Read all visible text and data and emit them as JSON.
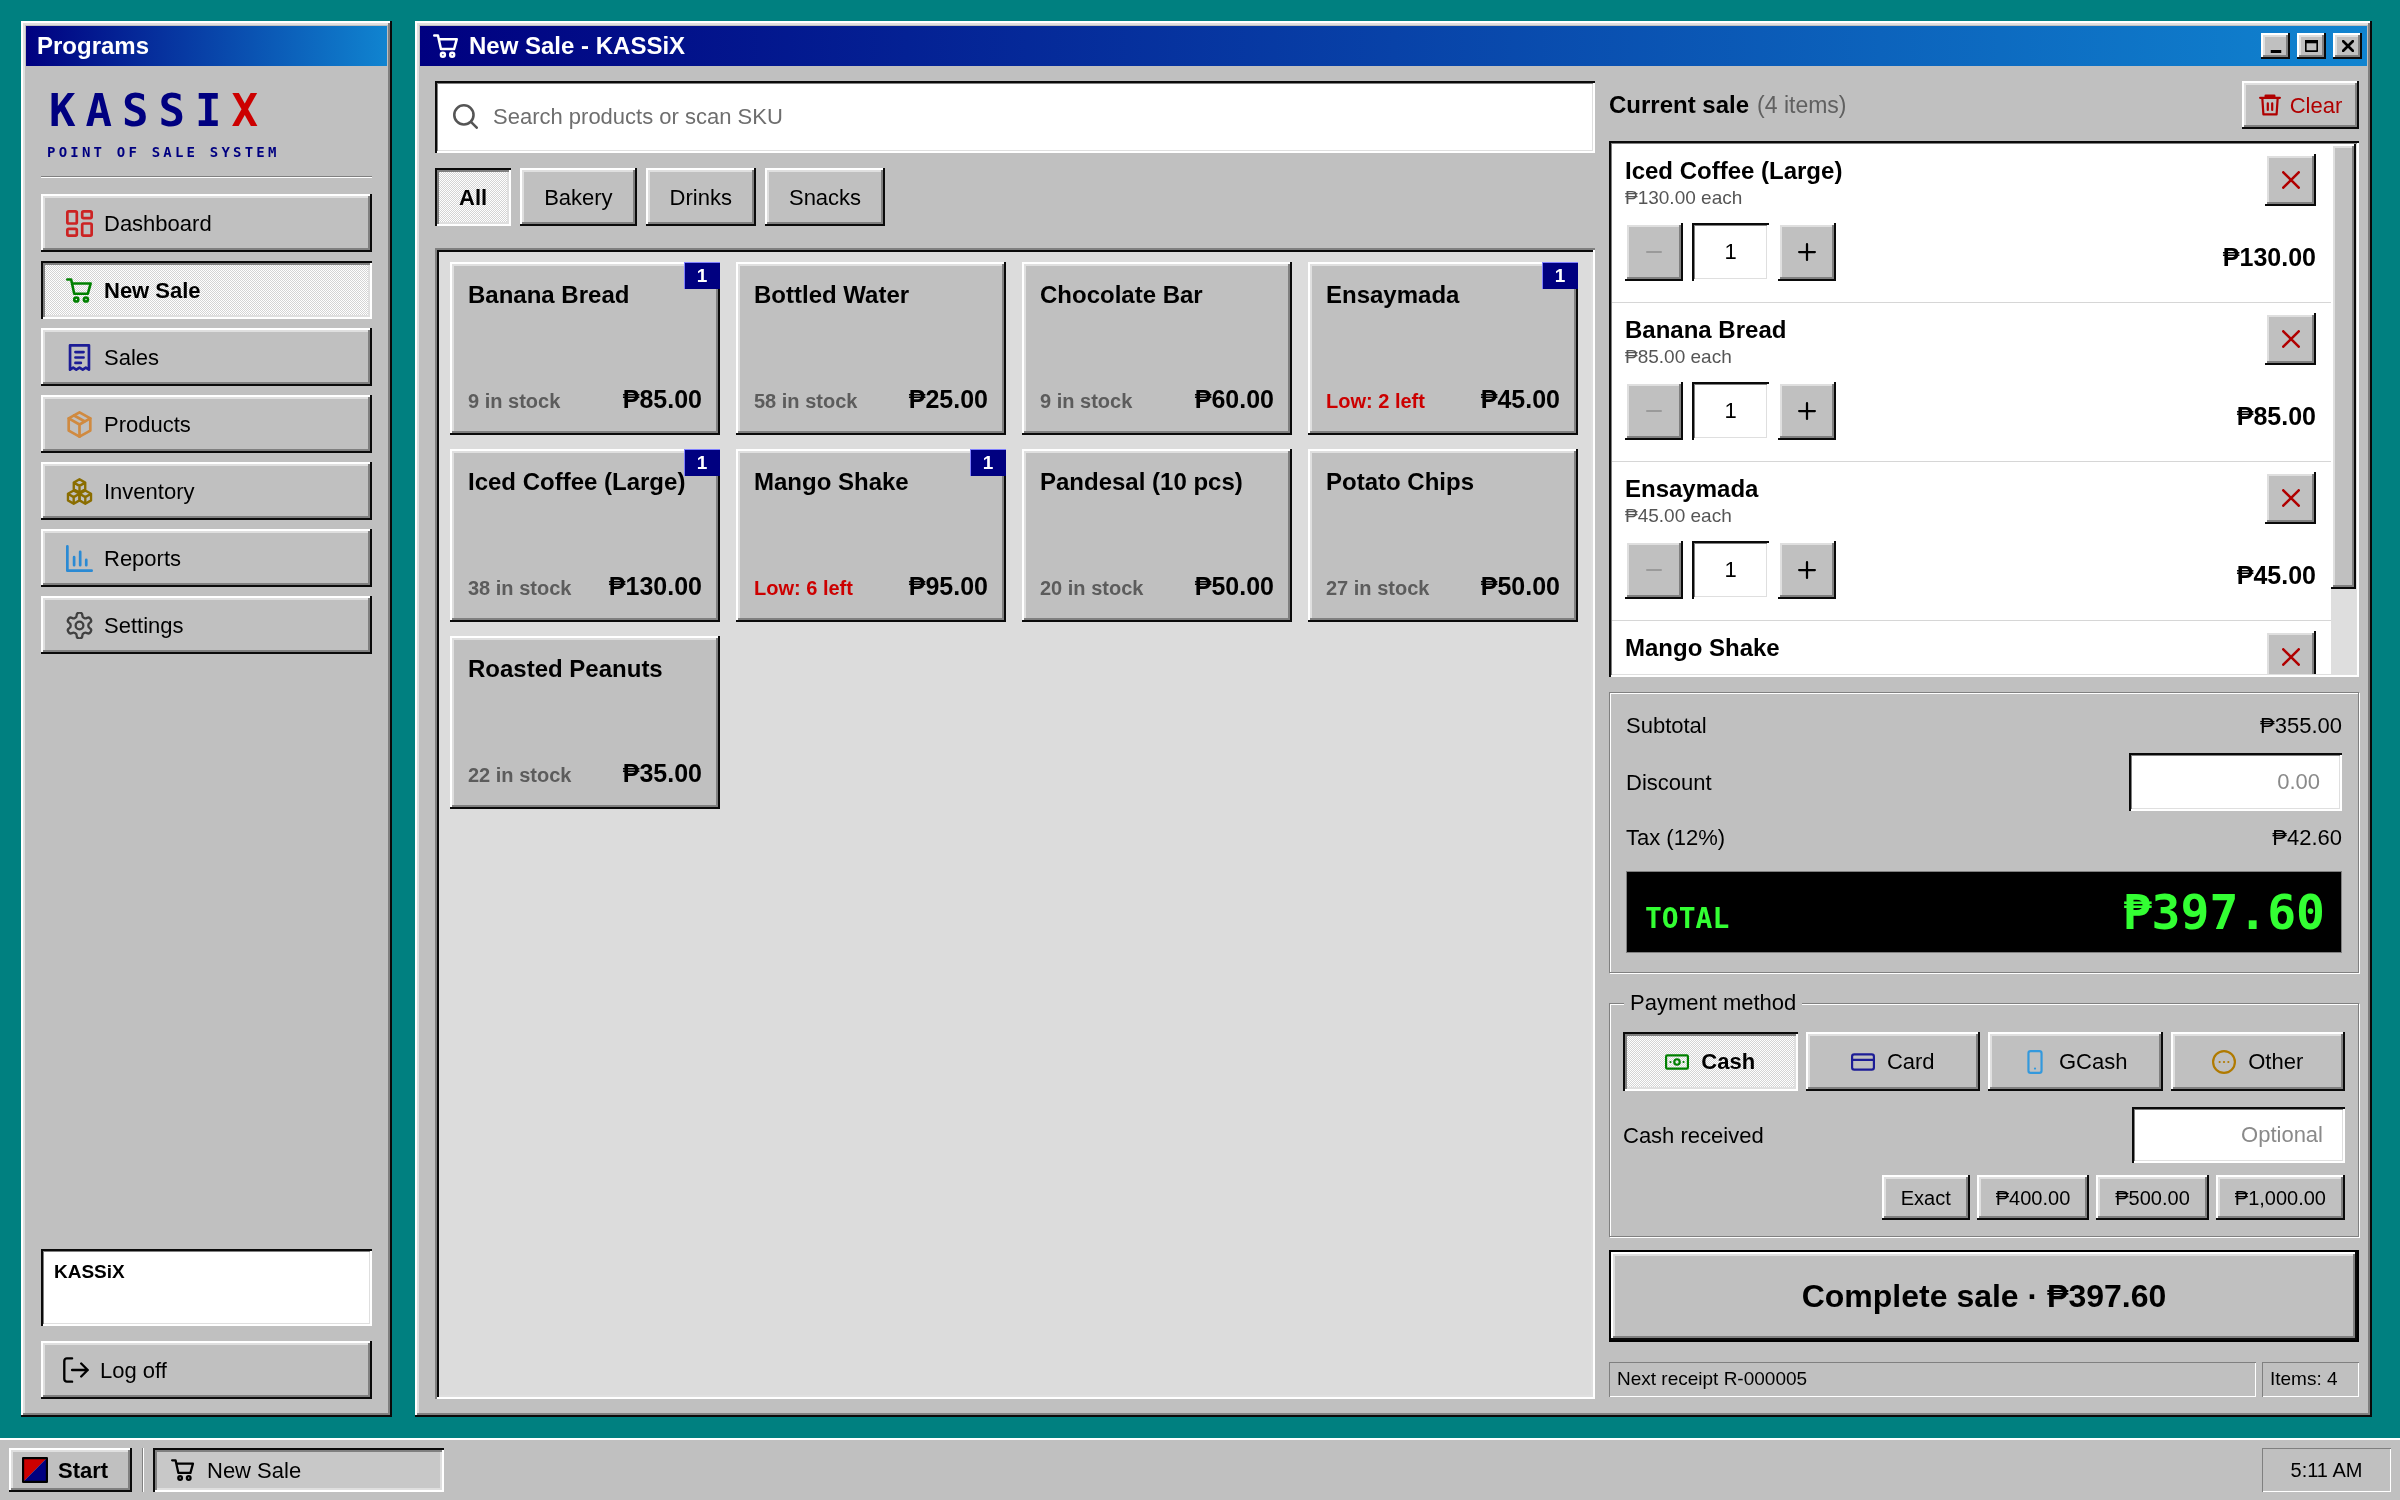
{
  "sidebar": {
    "title": "Programs",
    "logo": "KASSIX",
    "tagline": "POINT OF SALE SYSTEM",
    "nav": [
      {
        "label": "Dashboard",
        "kind": "dashboard",
        "selected": false
      },
      {
        "label": "New Sale",
        "kind": "cart",
        "selected": true
      },
      {
        "label": "Sales",
        "kind": "receipt",
        "selected": false
      },
      {
        "label": "Products",
        "kind": "package",
        "selected": false
      },
      {
        "label": "Inventory",
        "kind": "boxes",
        "selected": false
      },
      {
        "label": "Reports",
        "kind": "chart",
        "selected": false
      },
      {
        "label": "Settings",
        "kind": "gear",
        "selected": false
      }
    ],
    "user": "KASSiX",
    "logoff": "Log off"
  },
  "window": {
    "title": "New Sale - KASSiX"
  },
  "search": {
    "placeholder": "Search products or scan SKU"
  },
  "categories": [
    {
      "label": "All",
      "selected": true
    },
    {
      "label": "Bakery",
      "selected": false
    },
    {
      "label": "Drinks",
      "selected": false
    },
    {
      "label": "Snacks",
      "selected": false
    }
  ],
  "products": [
    {
      "name": "Banana Bread",
      "stock": "9 in stock",
      "low": false,
      "price": "₱85.00",
      "badge": "1"
    },
    {
      "name": "Bottled Water",
      "stock": "58 in stock",
      "low": false,
      "price": "₱25.00"
    },
    {
      "name": "Chocolate Bar",
      "stock": "9 in stock",
      "low": false,
      "price": "₱60.00"
    },
    {
      "name": "Ensaymada",
      "stock": "Low: 2 left",
      "low": true,
      "price": "₱45.00",
      "badge": "1"
    },
    {
      "name": "Iced Coffee (Large)",
      "stock": "38 in stock",
      "low": false,
      "price": "₱130.00",
      "badge": "1"
    },
    {
      "name": "Mango Shake",
      "stock": "Low: 6 left",
      "low": true,
      "price": "₱95.00",
      "badge": "1"
    },
    {
      "name": "Pandesal (10 pcs)",
      "stock": "20 in stock",
      "low": false,
      "price": "₱50.00"
    },
    {
      "name": "Potato Chips",
      "stock": "27 in stock",
      "low": false,
      "price": "₱50.00"
    },
    {
      "name": "Roasted Peanuts",
      "stock": "22 in stock",
      "low": false,
      "price": "₱35.00"
    }
  ],
  "cart": {
    "title": "Current sale",
    "count": "(4 items)",
    "clear": "Clear",
    "items": [
      {
        "name": "Iced Coffee (Large)",
        "unit": "₱130.00 each",
        "qty": "1",
        "decrease_disabled": true,
        "total": "₱130.00"
      },
      {
        "name": "Banana Bread",
        "unit": "₱85.00 each",
        "qty": "1",
        "decrease_disabled": true,
        "total": "₱85.00"
      },
      {
        "name": "Ensaymada",
        "unit": "₱45.00 each",
        "qty": "1",
        "decrease_disabled": true,
        "total": "₱45.00"
      },
      {
        "name": "Mango Shake"
      }
    ]
  },
  "totals": {
    "subtotal_label": "Subtotal",
    "subtotal": "₱355.00",
    "discount_label": "Discount",
    "discount_placeholder": "0.00",
    "tax_label": "Tax (12%)",
    "tax": "₱42.60",
    "total_label": "TOTAL",
    "total": "₱397.60"
  },
  "payment": {
    "title": "Payment method",
    "methods": [
      {
        "label": "Cash",
        "kind": "cash",
        "selected": true
      },
      {
        "label": "Card",
        "kind": "card",
        "selected": false
      },
      {
        "label": "GCash",
        "kind": "phone",
        "selected": false
      },
      {
        "label": "Other",
        "kind": "more",
        "selected": false
      }
    ],
    "cash_label": "Cash received",
    "cash_placeholder": "Optional",
    "quick_amounts": [
      "Exact",
      "₱400.00",
      "₱500.00",
      "₱1,000.00"
    ]
  },
  "complete_button": "Complete sale · ₱397.60",
  "status_bar": [
    "Next receipt R-000005",
    "Items: 4"
  ],
  "taskbar": {
    "start": "Start",
    "tasks": [
      {
        "label": "New Sale",
        "selected": true
      }
    ],
    "clock": "5:11 AM"
  }
}
